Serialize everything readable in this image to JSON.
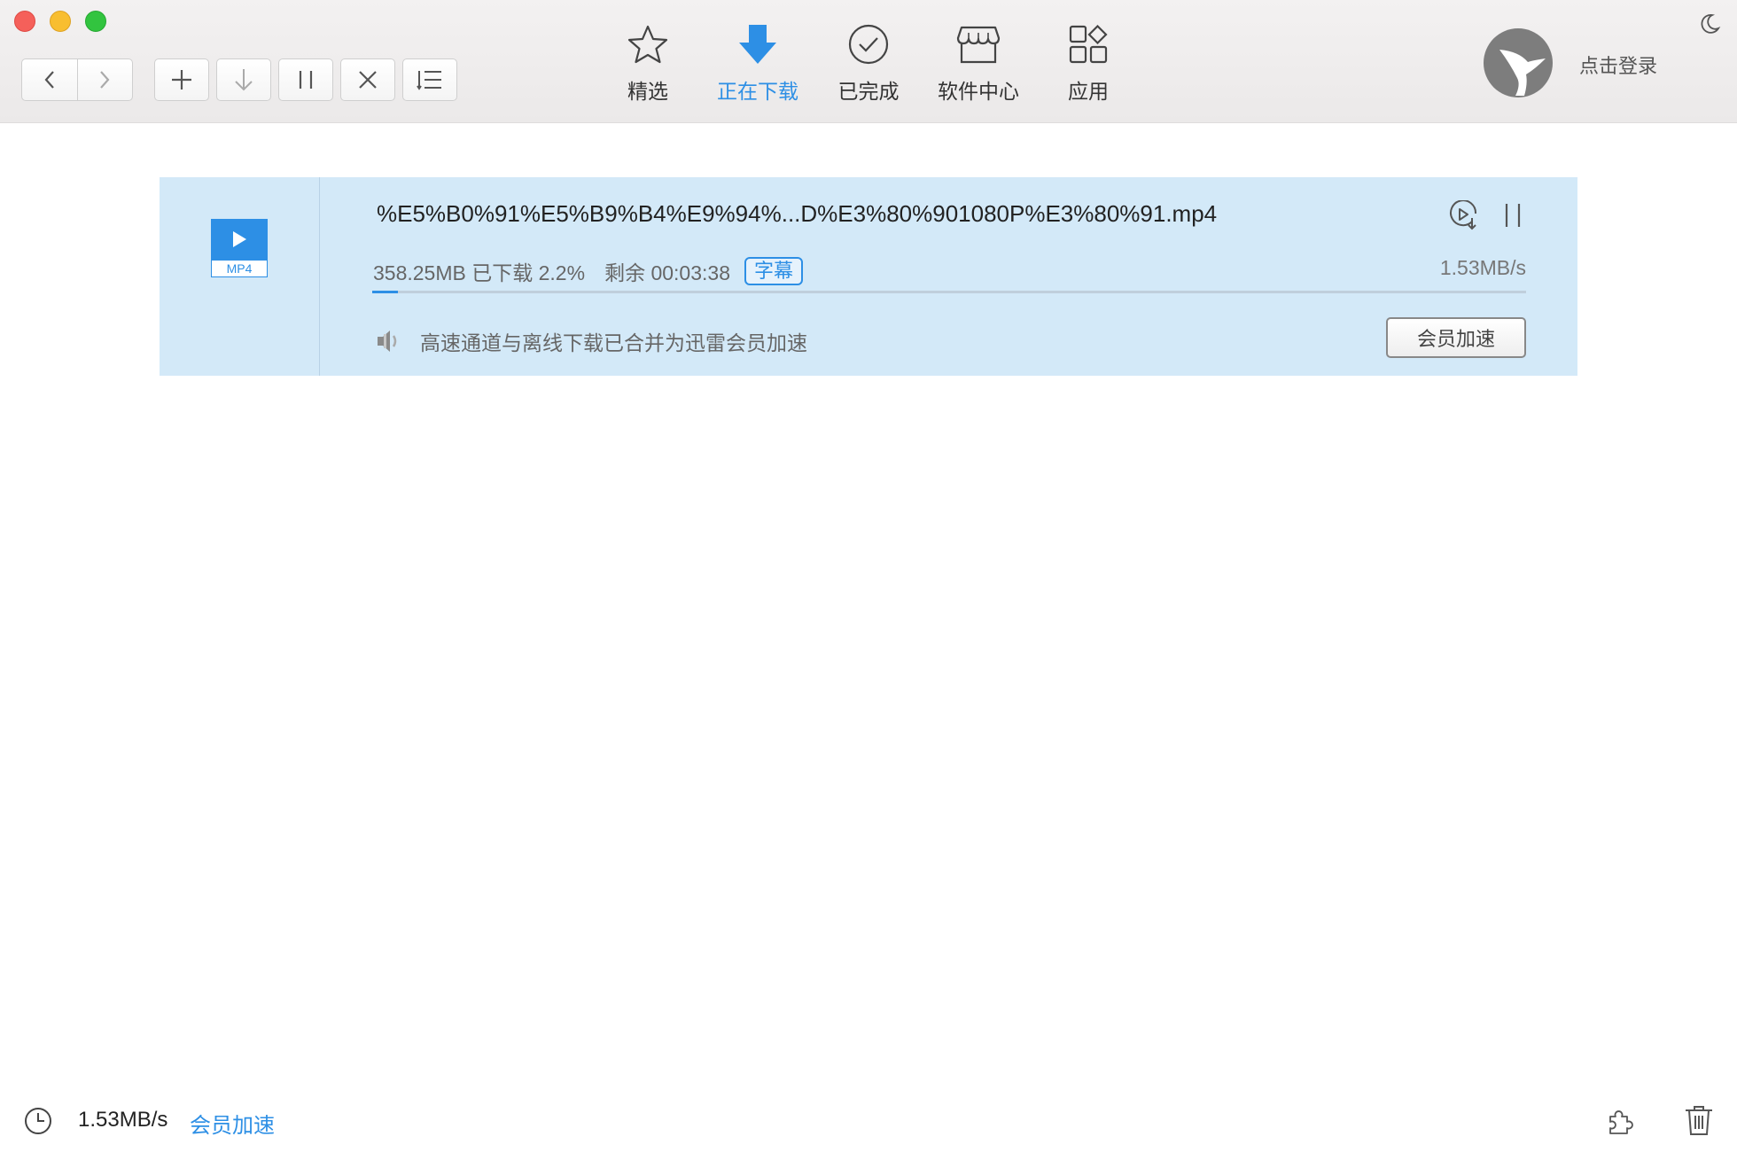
{
  "toolbar": {
    "tabs": [
      {
        "label": "精选",
        "icon": "star-icon"
      },
      {
        "label": "正在下载",
        "icon": "download-arrow-icon",
        "active": true
      },
      {
        "label": "已完成",
        "icon": "check-circle-icon"
      },
      {
        "label": "软件中心",
        "icon": "store-icon"
      },
      {
        "label": "应用",
        "icon": "apps-grid-icon"
      }
    ],
    "login_label": "点击登录",
    "accent_color": "#2d8fe5"
  },
  "download": {
    "filename": "%E5%B0%91%E5%B9%B4%E9%94%...D%E3%80%901080P%E3%80%91.mp4",
    "file_type": "MP4",
    "size_progress": "358.25MB 已下载 2.2%",
    "remaining": "剩余 00:03:38",
    "subtitle_tag": "字幕",
    "speed": "1.53MB/s",
    "progress": 0.022,
    "notice": "高速通道与离线下载已合并为迅雷会员加速",
    "vip_button": "会员加速"
  },
  "statusbar": {
    "speed": "1.53MB/s",
    "vip_link": "会员加速"
  }
}
